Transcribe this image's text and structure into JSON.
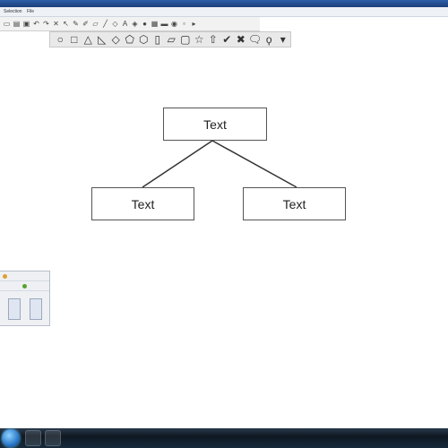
{
  "menu": {
    "items": [
      "Selection",
      "File"
    ]
  },
  "toolbar1": {
    "icons": [
      "new-page-icon",
      "open-icon",
      "save-icon",
      "undo-icon",
      "redo-icon",
      "delete-icon",
      "select-icon",
      "pen-icon",
      "highlighter-icon",
      "eraser-icon",
      "line-icon",
      "shape-icon",
      "text-icon",
      "fill-icon",
      "color-icon",
      "table-icon",
      "screen-shade-icon",
      "spotlight-icon",
      "camera-icon",
      "more-icon"
    ]
  },
  "toolbar2": {
    "shapes": [
      {
        "name": "circle-shape-icon",
        "glyph": "○"
      },
      {
        "name": "square-shape-icon",
        "glyph": "□"
      },
      {
        "name": "triangle-shape-icon",
        "glyph": "△"
      },
      {
        "name": "right-triangle-shape-icon",
        "glyph": "◺"
      },
      {
        "name": "diamond-shape-icon",
        "glyph": "◇"
      },
      {
        "name": "pentagon-shape-icon",
        "glyph": "⬠"
      },
      {
        "name": "hexagon-shape-icon",
        "glyph": "⬡"
      },
      {
        "name": "cylinder-shape-icon",
        "glyph": "▯"
      },
      {
        "name": "parallelogram-shape-icon",
        "glyph": "▱"
      },
      {
        "name": "frame-shape-icon",
        "glyph": "▢"
      },
      {
        "name": "star-shape-icon",
        "glyph": "☆"
      },
      {
        "name": "arrow-up-shape-icon",
        "glyph": "⇧"
      },
      {
        "name": "checkmark-shape-icon",
        "glyph": "✔"
      },
      {
        "name": "x-mark-shape-icon",
        "glyph": "✖"
      },
      {
        "name": "speech-bubble-shape-icon",
        "glyph": "🗨"
      },
      {
        "name": "thought-bubble-shape-icon",
        "glyph": "ϙ"
      },
      {
        "name": "more-shapes-icon",
        "glyph": "▾"
      }
    ]
  },
  "diagram": {
    "root": {
      "text": "Text"
    },
    "left": {
      "text": "Text"
    },
    "right": {
      "text": "Text"
    }
  },
  "palette": {
    "accent": "#5aa02c",
    "warn": "#e0a030"
  },
  "colors": {
    "taskbar": "#162a3c",
    "titlebar": "#2e5fa8"
  }
}
